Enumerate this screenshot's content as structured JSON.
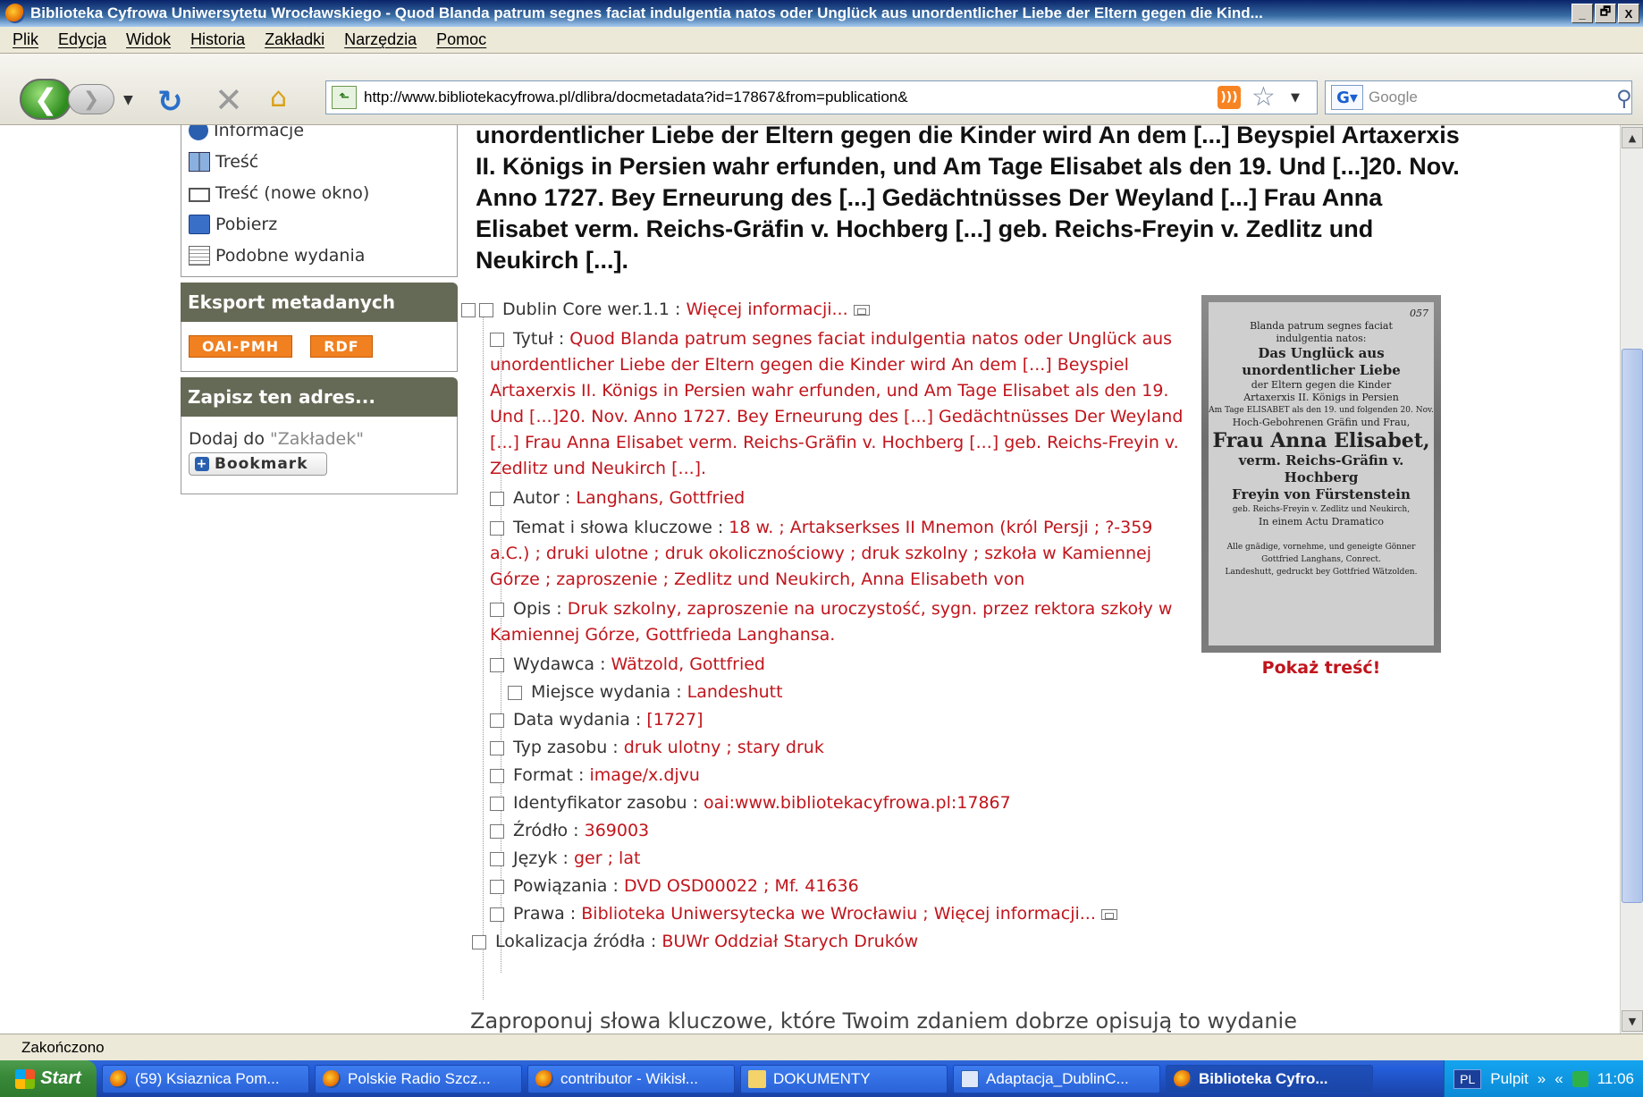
{
  "window": {
    "title": "Biblioteka Cyfrowa Uniwersytetu Wrocławskiego - Quod Blanda patrum segnes faciat indulgentia natos oder Unglück aus unordentlicher Liebe der Eltern gegen die Kind...",
    "min": "_",
    "max": "🗗",
    "close": "X"
  },
  "menu": [
    "Plik",
    "Edycja",
    "Widok",
    "Historia",
    "Zakładki",
    "Narzędzia",
    "Pomoc"
  ],
  "nav": {
    "url": "http://www.bibliotekacyfrowa.pl/dlibra/docmetadata?id=17867&from=publication&",
    "search_placeholder": "Google"
  },
  "sidebar": {
    "menu_items": [
      {
        "label": "Informacje",
        "icon": "info-icon"
      },
      {
        "label": "Treść",
        "icon": "book-icon"
      },
      {
        "label": "Treść (nowe okno)",
        "icon": "new-window-icon"
      },
      {
        "label": "Pobierz",
        "icon": "save-icon"
      },
      {
        "label": "Podobne wydania",
        "icon": "similar-icon"
      }
    ],
    "export_header": "Eksport metadanych",
    "export_buttons": [
      "OAI-PMH",
      "RDF"
    ],
    "save_header": "Zapisz ten adres...",
    "add_to": "Dodaj do",
    "bookmarks_quoted": "\"Zakładek\"",
    "bookmark_button": "Bookmark"
  },
  "heading": "unordentlicher Liebe der Eltern gegen die Kinder wird An dem [...] Beyspiel Artaxerxis II. Königs in Persien wahr erfunden, und Am Tage Elisabet als den 19. Und [...]20. Nov. Anno 1727. Bey Erneurung des [...] Gedächtnüsses Der Weyland [...] Frau Anna Elisabet verm. Reichs-Gräfin v. Hochberg [...] geb. Reichs-Freyin v. Zedlitz und Neukirch [...].",
  "metadata": {
    "root_label": "Dublin Core wer.1.1",
    "root_link": "Więcej informacji...",
    "fields": [
      {
        "label": "Tytuł",
        "value": "Quod Blanda patrum segnes faciat indulgentia natos oder Unglück aus unordentlicher Liebe der Eltern gegen die Kinder wird An dem [...] Beyspiel Artaxerxis II. Königs in Persien wahr erfunden, und Am Tage Elisabet als den 19. Und [...]20. Nov. Anno 1727. Bey Erneurung des [...] Gedächtnüsses Der Weyland [...] Frau Anna Elisabet verm. Reichs-Gräfin v. Hochberg [...] geb. Reichs-Freyin v. Zedlitz und Neukirch [...]."
      },
      {
        "label": "Autor",
        "value": "Langhans, Gottfried"
      },
      {
        "label": "Temat i słowa kluczowe",
        "value": "18 w. ; Artakserkses II Mnemon (król Persji ; ?-359 a.C.) ; druki ulotne ; druk okolicznościowy ; druk szkolny ; szkoła w Kamiennej Górze ; zaproszenie ; Zedlitz und Neukirch, Anna Elisabeth von"
      },
      {
        "label": "Opis",
        "value": "Druk szkolny, zaproszenie na uroczystość, sygn. przez rektora szkoły w Kamiennej Górze, Gottfrieda Langhansa."
      },
      {
        "label": "Wydawca",
        "value": "Wätzold, Gottfried"
      },
      {
        "label": "Miejsce wydania",
        "value": "Landeshutt"
      },
      {
        "label": "Data wydania",
        "value": "[1727]"
      },
      {
        "label": "Typ zasobu",
        "value": "druk ulotny ; stary druk"
      },
      {
        "label": "Format",
        "value": "image/x.djvu"
      },
      {
        "label": "Identyfikator zasobu",
        "value": "oai:www.bibliotekacyfrowa.pl:17867"
      },
      {
        "label": "Źródło",
        "value": "369003"
      },
      {
        "label": "Język",
        "value": "ger ; lat"
      },
      {
        "label": "Powiązania",
        "value": "DVD OSD00022 ; Mf. 41636"
      },
      {
        "label": "Prawa",
        "value": "Biblioteka Uniwersytecka we Wrocławiu ; Więcej informacji..."
      },
      {
        "label": "Lokalizacja źródła",
        "value": "BUWr Oddział Starych Druków"
      }
    ]
  },
  "thumbnail": {
    "corner_mark": "057",
    "lines": [
      "Blanda patrum segnes faciat",
      "indulgentia natos:",
      "Das Unglück aus unordentlicher Liebe",
      "der Eltern gegen die Kinder",
      "Artaxerxis II. Königs in Persien",
      "Am Tage ELISABET als den 19. und folgenden 20. Nov.",
      "Hoch-Gebohrenen Gräfin und Frau,",
      "Frau Anna Elisabet,",
      "verm. Reichs-Gräfin v. Hochberg",
      "Freyin von Fürstenstein",
      "geb. Reichs-Freyin v. Zedlitz und Neukirch,",
      "In einem Actu Dramatico",
      "Alle gnädige, vornehme, und geneigte Gönner",
      "Gottfried Langhans, Conrect.",
      "Landeshutt, gedruckt bey Gottfried Wätzolden."
    ],
    "show_content": "Pokaż treść!"
  },
  "suggest_text": "Zaproponuj słowa kluczowe, które Twoim zdaniem dobrze opisują to wydanie",
  "status": "Zakończono",
  "taskbar": {
    "start": "Start",
    "items": [
      {
        "label": "(59) Ksiaznica Pom...",
        "active": false
      },
      {
        "label": "Polskie Radio Szcz...",
        "active": false
      },
      {
        "label": "contributor - Wikisł...",
        "active": false
      },
      {
        "label": "DOKUMENTY",
        "active": false
      },
      {
        "label": "Adaptacja_DublinC...",
        "active": false
      },
      {
        "label": "Biblioteka Cyfro...",
        "active": true
      }
    ],
    "lang": "PL",
    "desktop": "Pulpit",
    "time": "11:06"
  }
}
